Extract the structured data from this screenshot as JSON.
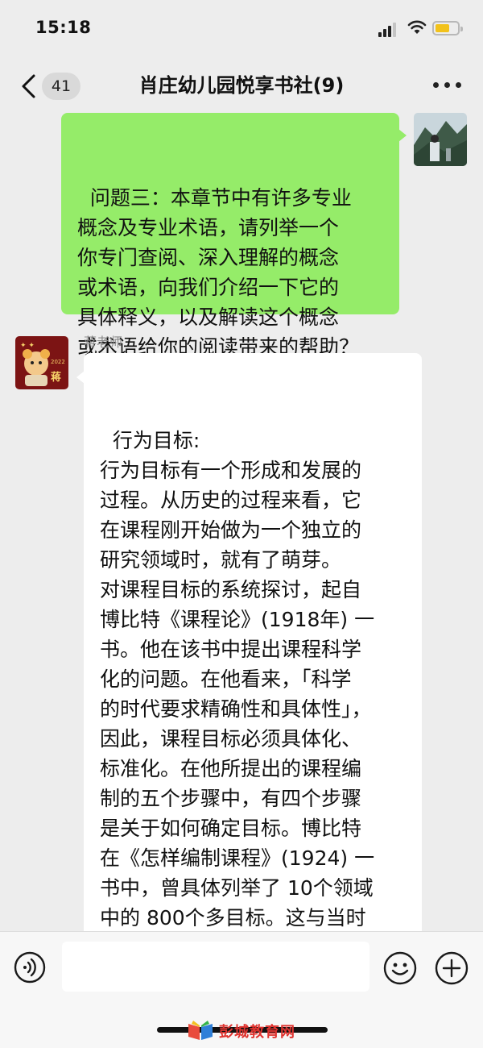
{
  "status_bar": {
    "time": "15:18",
    "battery_color": "#f2c21b"
  },
  "header": {
    "unread_count": "41",
    "title": "肖庄幼儿园悦享书社(9)",
    "more_icon": "ellipsis-icon",
    "back_icon": "chevron-left-icon"
  },
  "messages": [
    {
      "direction": "outgoing",
      "bubble_color": "#95ec69",
      "text": "问题三：本章节中有许多专业\n概念及专业术语，请列举一个\n你专门查阅、深入理解的概念\n或术语，向我们介绍一下它的\n具体释义，以及解读这个概念\n或术语给你的阅读带来的帮助？"
    },
    {
      "direction": "incoming",
      "sender": "蒋老师",
      "avatar_text": "2022",
      "avatar_char": "蒋",
      "text": "行为目标:\n行为目标有一个形成和发展的\n过程。从历史的过程来看，它\n在课程刚开始做为一个独立的\n研究领域时，就有了萌芽。\n对课程目标的系统探讨，起自\n博比特《课程论》(1918年) 一\n书。他在该书中提出课程科学\n化的问题。在他看来，「科学\n的时代要求精确性和具体性」，\n因此，课程目标必须具体化、\n标准化。在他所提出的课程编\n制的五个步骤中，有四个步骤\n是关于如何确定目标。博比特\n在《怎样编制课程》(1924) 一\n书中，曾具体列举了 10个领域\n中的 800个多目标。这与当时\n美国流行的刺激---反应学习理\n论是相互呼应的。"
    }
  ],
  "input_bar": {
    "voice_icon": "voice-icon",
    "emoji_icon": "emoji-icon",
    "plus_icon": "plus-icon"
  },
  "watermark": {
    "text": "彭城教育网"
  }
}
